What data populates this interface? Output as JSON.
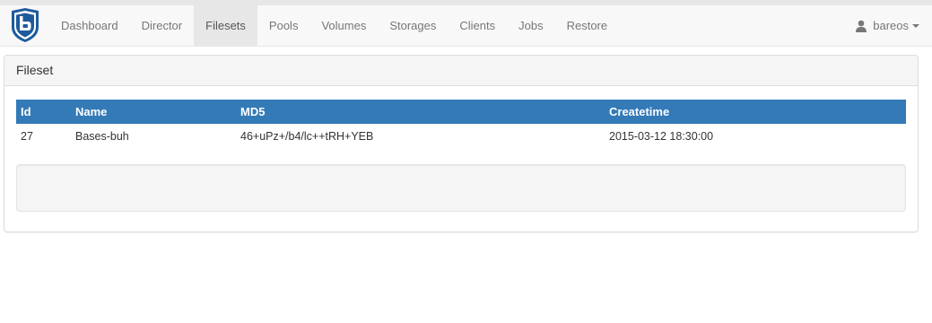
{
  "navbar": {
    "logo_icon": "bareos-logo-icon",
    "items": [
      {
        "label": "Dashboard",
        "active": false
      },
      {
        "label": "Director",
        "active": false
      },
      {
        "label": "Filesets",
        "active": true
      },
      {
        "label": "Pools",
        "active": false
      },
      {
        "label": "Volumes",
        "active": false
      },
      {
        "label": "Storages",
        "active": false
      },
      {
        "label": "Clients",
        "active": false
      },
      {
        "label": "Jobs",
        "active": false
      },
      {
        "label": "Restore",
        "active": false
      }
    ],
    "user": {
      "name": "bareos",
      "icon": "user-icon"
    }
  },
  "panel": {
    "title": "Fileset",
    "table": {
      "headers": [
        "Id",
        "Name",
        "MD5",
        "Createtime"
      ],
      "rows": [
        [
          "27",
          "Bases-buh",
          "46+uPz+/b4/lc++tRH+YEB",
          "2015-03-12 18:30:00"
        ]
      ]
    }
  },
  "colors": {
    "brand": "#1e5b9c",
    "table_header": "#337ab7",
    "navbar_bg": "#f8f8f8",
    "active_nav_bg": "#e7e7e7"
  }
}
